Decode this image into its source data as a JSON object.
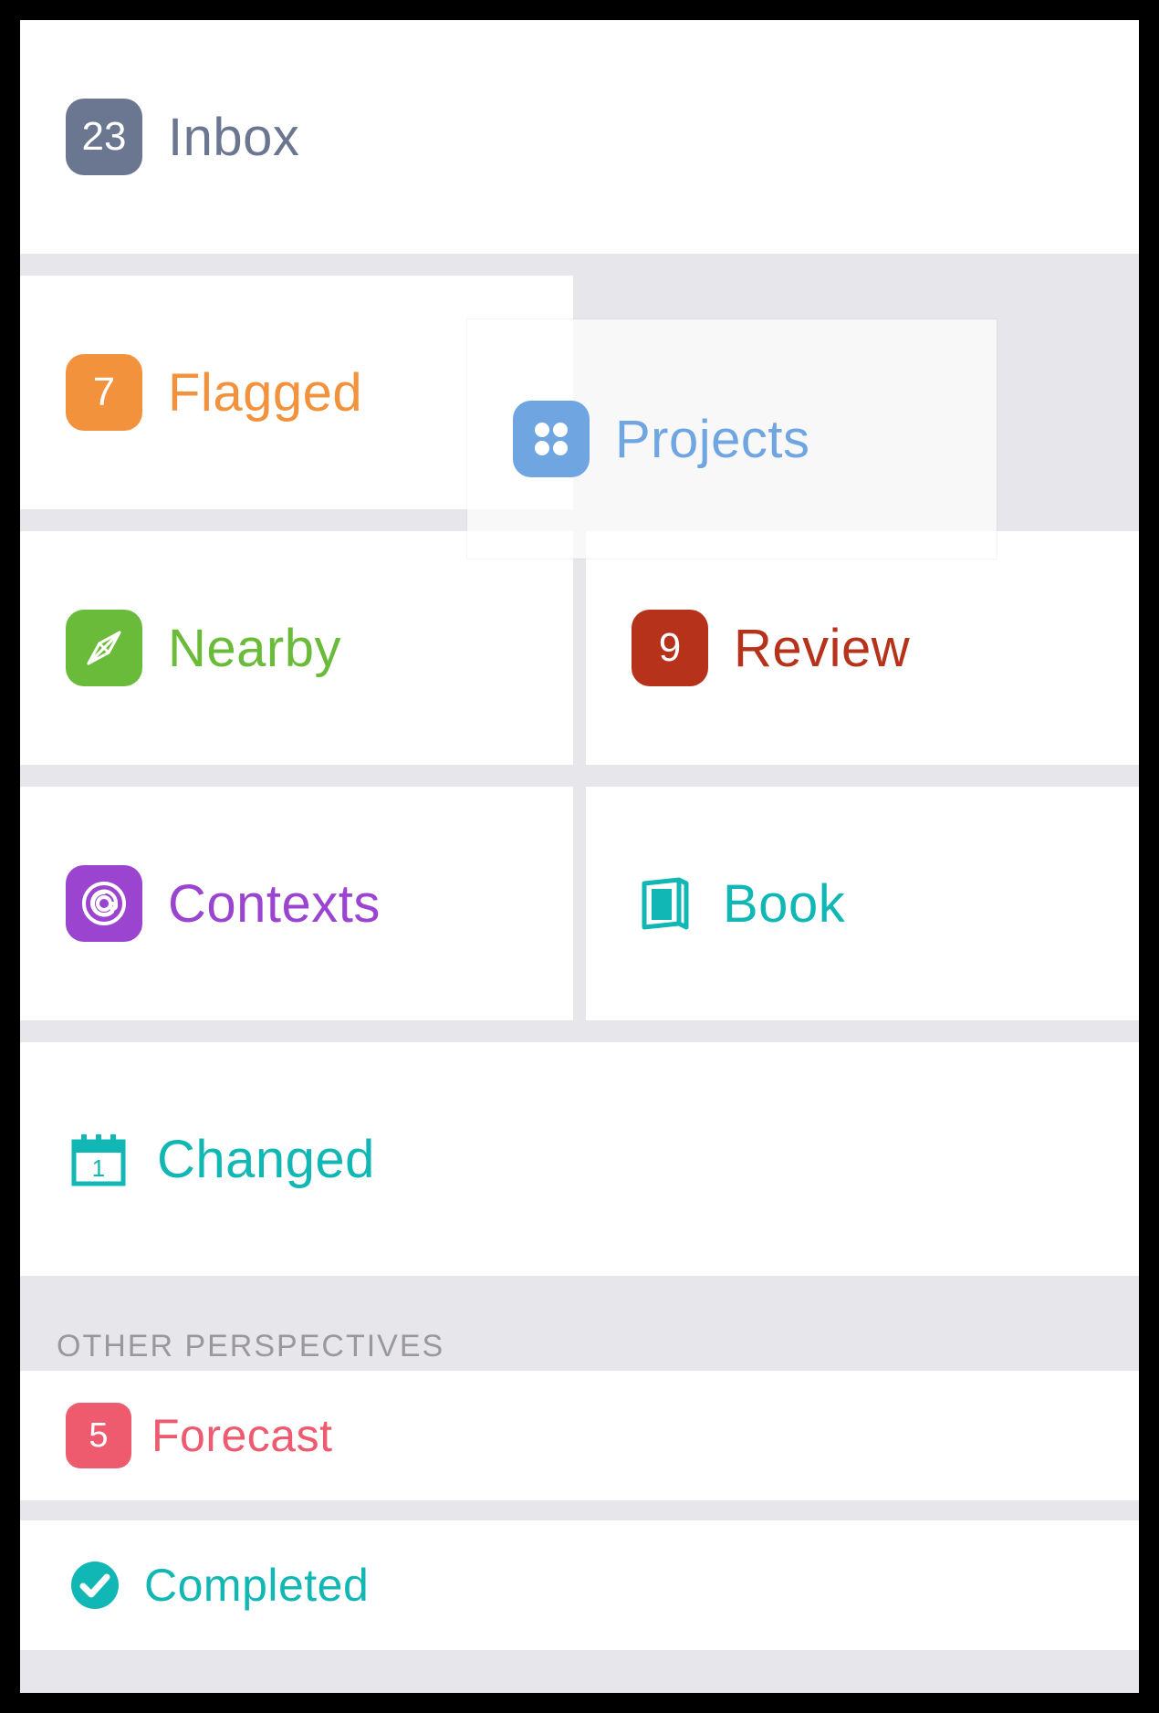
{
  "tiles": {
    "inbox": {
      "label": "Inbox",
      "count": "23"
    },
    "flagged": {
      "label": "Flagged",
      "count": "7"
    },
    "projects": {
      "label": "Projects"
    },
    "nearby": {
      "label": "Nearby"
    },
    "review": {
      "label": "Review",
      "count": "9"
    },
    "contexts": {
      "label": "Contexts"
    },
    "book": {
      "label": "Book"
    },
    "changed": {
      "label": "Changed"
    }
  },
  "section_header": "OTHER PERSPECTIVES",
  "other": {
    "forecast": {
      "label": "Forecast",
      "count": "5"
    },
    "completed": {
      "label": "Completed"
    }
  },
  "colors": {
    "inbox": "#6b7690",
    "flagged": "#f2923c",
    "projects": "#6fa6e2",
    "nearby": "#6bbb3a",
    "review": "#b6321b",
    "contexts": "#9a44d0",
    "teal": "#10b7b4",
    "forecast": "#ee5a6e"
  }
}
